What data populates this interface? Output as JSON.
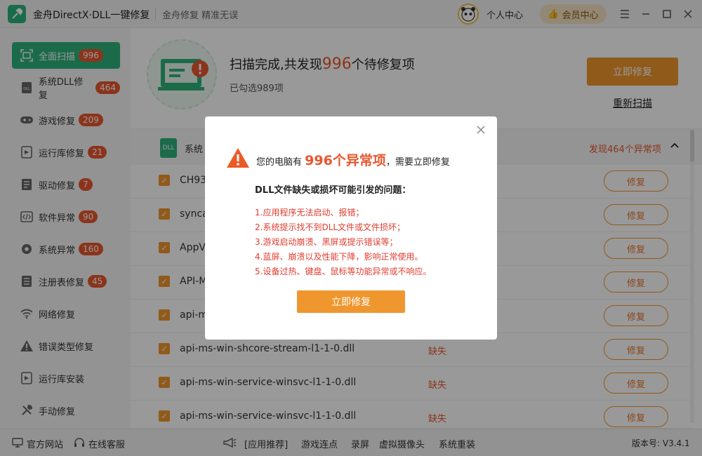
{
  "titlebar": {
    "app_title": "金舟DirectX·DLL一键修复",
    "slogan": "金舟修复 精准无误",
    "personal_center": "个人中心",
    "member_center": "会员中心"
  },
  "sidebar": {
    "items": [
      {
        "label": "全面扫描",
        "badge": "996",
        "icon": "scan-icon",
        "active": true
      },
      {
        "label": "系统DLL修复",
        "badge": "464",
        "icon": "dll-icon"
      },
      {
        "label": "游戏修复",
        "badge": "209",
        "icon": "gamepad-icon"
      },
      {
        "label": "运行库修复",
        "badge": "21",
        "icon": "runtime-icon"
      },
      {
        "label": "驱动修复",
        "badge": "7",
        "icon": "driver-icon"
      },
      {
        "label": "软件异常",
        "badge": "90",
        "icon": "code-icon"
      },
      {
        "label": "系统异常",
        "badge": "160",
        "icon": "gear-icon"
      },
      {
        "label": "注册表修复",
        "badge": "45",
        "icon": "registry-icon"
      },
      {
        "label": "网络修复",
        "badge": "",
        "icon": "wifi-icon"
      },
      {
        "label": "错误类型修复",
        "badge": "",
        "icon": "warning-icon"
      },
      {
        "label": "运行库安装",
        "badge": "",
        "icon": "install-icon"
      },
      {
        "label": "手动修复",
        "badge": "",
        "icon": "wrench-icon"
      }
    ]
  },
  "scan": {
    "title_prefix": "扫描完成,共发现",
    "count": "996",
    "title_suffix": "个待修复项",
    "selected": "已勾选989项",
    "fix_button": "立即修复",
    "rescan": "重新扫描"
  },
  "list": {
    "group_label": "系统",
    "group_count": "发现464个异常项",
    "rows": [
      {
        "name": "CH93",
        "status": "",
        "action": "修复"
      },
      {
        "name": "synca",
        "status": "",
        "action": "修复"
      },
      {
        "name": "AppV",
        "status": "",
        "action": "修复"
      },
      {
        "name": "API-M",
        "status": "",
        "action": "修复"
      },
      {
        "name": "api-m",
        "status": "",
        "action": "修复"
      },
      {
        "name": "api-ms-win-shcore-stream-l1-1-0.dll",
        "status": "缺失",
        "action": "修复"
      },
      {
        "name": "api-ms-win-service-winsvc-l1-1-0.dll",
        "status": "缺失",
        "action": "修复"
      },
      {
        "name": "api-ms-win-service-winsvc-l1-1-0.dll",
        "status": "缺失",
        "action": "修复"
      }
    ]
  },
  "footer": {
    "official_site": "官方网站",
    "online_service": "在线客服",
    "recommend": "[应用推荐]",
    "links": [
      "游戏连点",
      "录屏",
      "虚拟摄像头",
      "系统重装"
    ],
    "version": "版本号: V3.4.1"
  },
  "modal": {
    "headline_prefix": "您的电脑有",
    "headline_count": "996个异常项",
    "headline_suffix": "，需要立即修复",
    "subtitle": "DLL文件缺失或损坏可能引发的问题：",
    "items": [
      "1.应用程序无法启动、报错；",
      "2.系统提示找不到DLL文件或文件损坏；",
      "3.游戏启动崩溃、黑屏或提示错误等；",
      "4.蓝屏、崩溃以及性能下降，影响正常使用。",
      "5.设备过热、键盘、鼠标等功能异常或不响应。"
    ],
    "button": "立即修复"
  },
  "colors": {
    "accent_green": "#2db37e",
    "accent_orange": "#f0962e",
    "alert_red": "#e8572e"
  }
}
